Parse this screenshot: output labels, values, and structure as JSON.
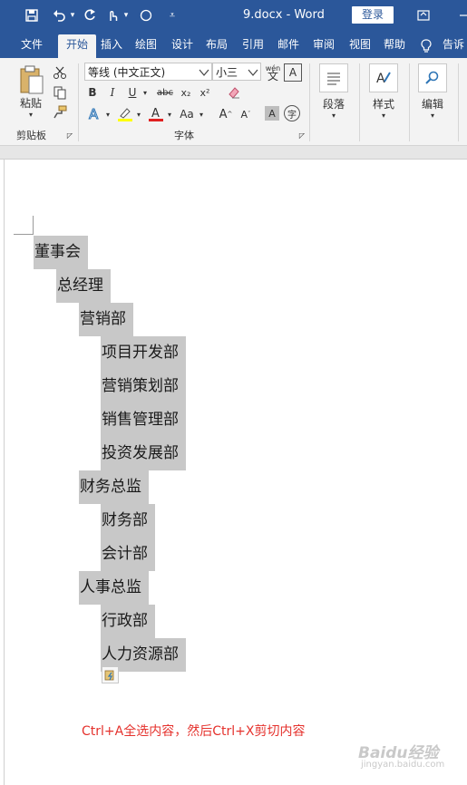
{
  "window": {
    "title": "9.docx - Word",
    "login_label": "登录"
  },
  "tabs": [
    "文件",
    "开始",
    "插入",
    "绘图",
    "设计",
    "布局",
    "引用",
    "邮件",
    "审阅",
    "视图",
    "帮助",
    "告诉"
  ],
  "active_tab": "开始",
  "ribbon": {
    "clipboard": {
      "paste_label": "粘贴",
      "group_label": "剪贴板"
    },
    "font": {
      "font_name": "等线 (中文正文)",
      "font_size": "小三",
      "group_label": "字体",
      "bold": "B",
      "italic": "I",
      "underline": "U",
      "strike": "abc",
      "subscript": "x₂",
      "superscript": "x²",
      "change_case": "Aa"
    },
    "paragraph": {
      "label": "段落"
    },
    "styles": {
      "label": "样式"
    },
    "editing": {
      "label": "编辑"
    }
  },
  "document": {
    "lines": [
      {
        "text": "董事会"
      },
      {
        "text": "总经理"
      },
      {
        "text": "营销部"
      },
      {
        "text": "项目开发部"
      },
      {
        "text": "营销策划部"
      },
      {
        "text": "销售管理部"
      },
      {
        "text": "投资发展部"
      },
      {
        "text": "财务总监"
      },
      {
        "text": "财务部"
      },
      {
        "text": "会计部"
      },
      {
        "text": "人事总监"
      },
      {
        "text": "行政部"
      },
      {
        "text": "人力资源部"
      }
    ],
    "caption": "Ctrl+A全选内容，然后Ctrl+X剪切内容"
  },
  "watermark": {
    "text": "Baidu经验",
    "sub": "jingyan.baidu.com"
  },
  "colors": {
    "title_bar": "#2b579a",
    "selection": "#c8c8c8",
    "caption": "#e5322d"
  }
}
